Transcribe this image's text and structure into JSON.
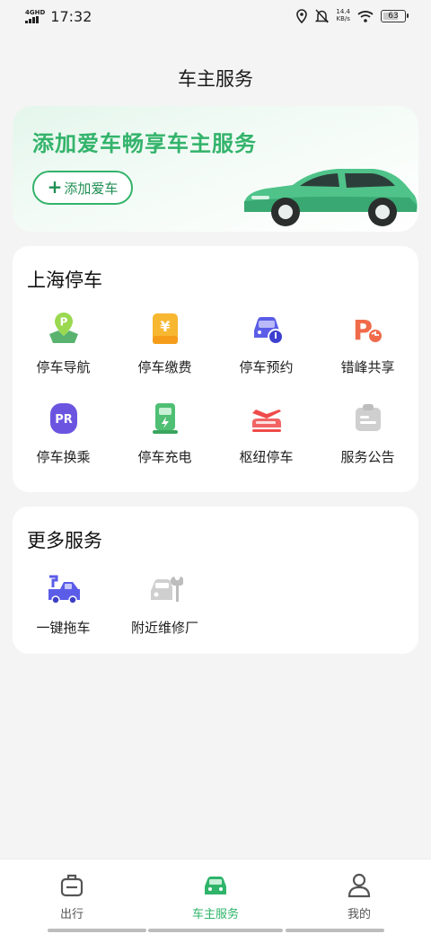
{
  "status_bar": {
    "network": "4GHD",
    "time": "17:32",
    "speed_value": "14.4",
    "speed_unit": "KB/s",
    "battery": "63"
  },
  "page_title": "车主服务",
  "banner": {
    "title": "添加爱车畅享车主服务",
    "button_label": "添加爱车"
  },
  "parking": {
    "title": "上海停车",
    "items": [
      {
        "label": "停车导航",
        "icon": "parking-navigation-icon"
      },
      {
        "label": "停车缴费",
        "icon": "parking-payment-icon"
      },
      {
        "label": "停车预约",
        "icon": "parking-reservation-icon"
      },
      {
        "label": "错峰共享",
        "icon": "off-peak-sharing-icon"
      },
      {
        "label": "停车换乘",
        "icon": "park-and-ride-icon"
      },
      {
        "label": "停车充电",
        "icon": "ev-charging-icon"
      },
      {
        "label": "枢纽停车",
        "icon": "hub-parking-icon"
      },
      {
        "label": "服务公告",
        "icon": "announcement-icon"
      }
    ]
  },
  "more": {
    "title": "更多服务",
    "items": [
      {
        "label": "一键拖车",
        "icon": "tow-truck-icon"
      },
      {
        "label": "附近维修厂",
        "icon": "repair-shop-icon"
      }
    ]
  },
  "bottom_nav": {
    "items": [
      {
        "label": "出行",
        "icon": "luggage-icon"
      },
      {
        "label": "车主服务",
        "icon": "car-icon"
      },
      {
        "label": "我的",
        "icon": "person-icon"
      }
    ],
    "active": "车主服务"
  },
  "colors": {
    "accent": "#33b36b",
    "background": "#f4f4f4",
    "card": "#ffffff"
  }
}
